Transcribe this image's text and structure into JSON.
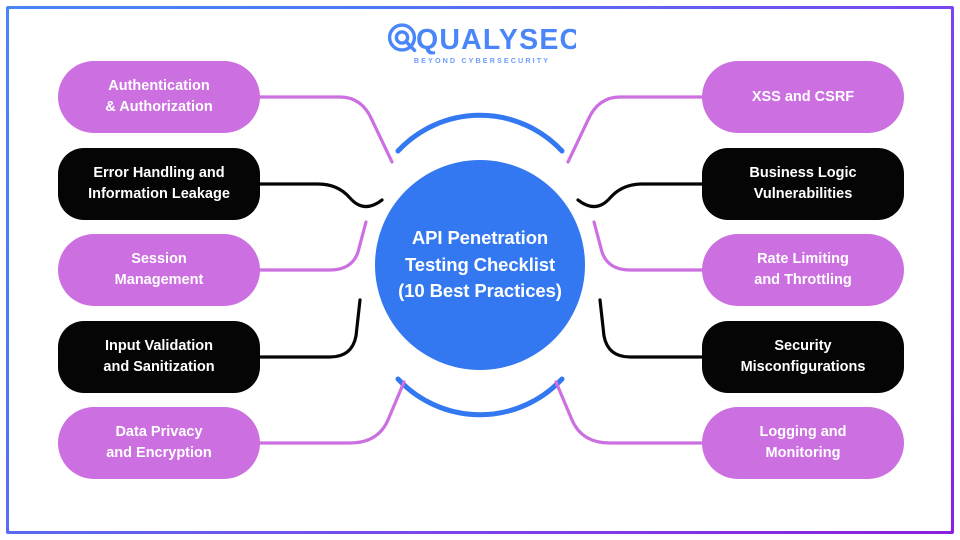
{
  "brand": {
    "name": "QUALYSEC",
    "tagline": "BEYOND CYBERSECURITY",
    "logo_icon": "magnifying-glass-q-icon",
    "color": "#4a86f7"
  },
  "frame": {
    "gradient_start": "#4a86f7",
    "gradient_end": "#8a1ee0"
  },
  "hub": {
    "title": "API Penetration\nTesting Checklist\n(10 Best Practices)",
    "color": "#3378f0",
    "arc_color": "#3378f0"
  },
  "colors": {
    "purple": "#cc6fe0",
    "black": "#050505",
    "blue": "#3378f0",
    "white": "#ffffff"
  },
  "chart_data": {
    "type": "diagram",
    "title": "API Penetration Testing Checklist (10 Best Practices)",
    "layout": "radial-mindmap",
    "center": "API Penetration Testing Checklist (10 Best Practices)",
    "count": 10,
    "items": [
      "Authentication & Authorization",
      "Error Handling and Information Leakage",
      "Session Management",
      "Input Validation and Sanitization",
      "Data Privacy and Encryption",
      "XSS and CSRF",
      "Business Logic Vulnerabilities",
      "Rate Limiting and Throttling",
      "Security Misconfigurations",
      "Logging and Monitoring"
    ]
  },
  "nodes": {
    "left": [
      {
        "label": "Authentication\n& Authorization",
        "style": "purple"
      },
      {
        "label": "Error Handling and\nInformation Leakage",
        "style": "black"
      },
      {
        "label": "Session\nManagement",
        "style": "purple"
      },
      {
        "label": "Input Validation\nand Sanitization",
        "style": "black"
      },
      {
        "label": "Data Privacy\nand Encryption",
        "style": "purple"
      }
    ],
    "right": [
      {
        "label": "XSS and CSRF",
        "style": "purple"
      },
      {
        "label": "Business Logic\nVulnerabilities",
        "style": "black"
      },
      {
        "label": "Rate Limiting\nand Throttling",
        "style": "purple"
      },
      {
        "label": "Security\nMisconfigurations",
        "style": "black"
      },
      {
        "label": "Logging and\nMonitoring",
        "style": "purple"
      }
    ]
  }
}
